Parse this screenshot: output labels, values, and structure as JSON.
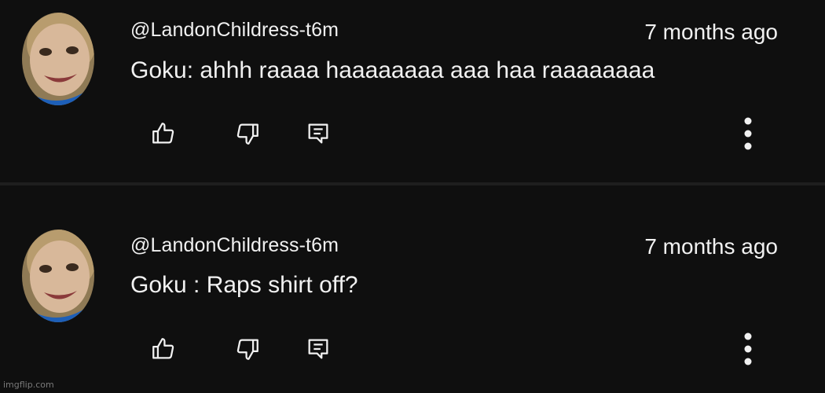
{
  "comments": [
    {
      "author": "@LandonChildress-t6m",
      "time": "7 months ago",
      "text": "Goku: ahhh raaaa haaaaaaaa aaa haa raaaaaaaa"
    },
    {
      "author": "@LandonChildress-t6m",
      "time": "7 months ago",
      "text": "Goku : Raps shirt off?"
    }
  ],
  "watermark": "imgflip.com",
  "icons": {
    "like": "thumbs-up-icon",
    "dislike": "thumbs-down-icon",
    "reply": "reply-icon",
    "more": "more-vertical-icon"
  },
  "colors": {
    "background": "#0f0f0f",
    "text": "#f1f1f1",
    "avatar_ring": "#1565c0"
  }
}
